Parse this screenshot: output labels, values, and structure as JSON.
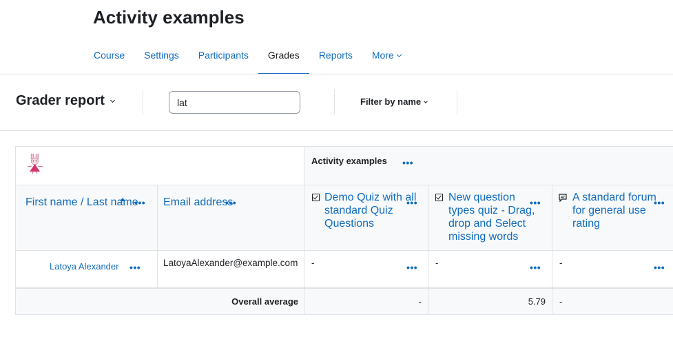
{
  "page": {
    "title": "Activity examples"
  },
  "nav": {
    "items": [
      {
        "label": "Course",
        "active": false
      },
      {
        "label": "Settings",
        "active": false
      },
      {
        "label": "Participants",
        "active": false
      },
      {
        "label": "Grades",
        "active": true
      },
      {
        "label": "Reports",
        "active": false
      },
      {
        "label": "More",
        "active": false
      }
    ]
  },
  "toolbar": {
    "report_selector": "Grader report",
    "search_value": "lat",
    "filter_label": "Filter by name"
  },
  "grader": {
    "category_header": "Activity examples",
    "columns": {
      "name": "First name / Last name",
      "email": "Email address",
      "items": [
        {
          "label": "Demo Quiz with all standard Quiz Questions",
          "lines": [
            "Demo Quiz with all",
            "standard Quiz",
            "Questions"
          ],
          "icon": "quiz-icon"
        },
        {
          "label": "New question types quiz - Drag, drop and Select missing words",
          "lines": [
            "New question",
            "types quiz - Drag,",
            "drop and Select",
            "missing words"
          ],
          "icon": "quiz-icon"
        },
        {
          "label": "A standard forum for general use rating",
          "lines": [
            "A standard forum",
            "for general use",
            "rating"
          ],
          "icon": "forum-icon"
        }
      ]
    },
    "rows": [
      {
        "name": "Latoya Alexander",
        "email": "LatoyaAlexander@example.com",
        "grades": [
          "-",
          "-",
          "-"
        ]
      }
    ],
    "average": {
      "label": "Overall average",
      "values": [
        "-",
        "5.79",
        "-"
      ]
    }
  },
  "colors": {
    "link": "#0f6cbf",
    "text": "#1d2125",
    "border": "#dee2e6",
    "header_bg": "#f8f9fa"
  }
}
